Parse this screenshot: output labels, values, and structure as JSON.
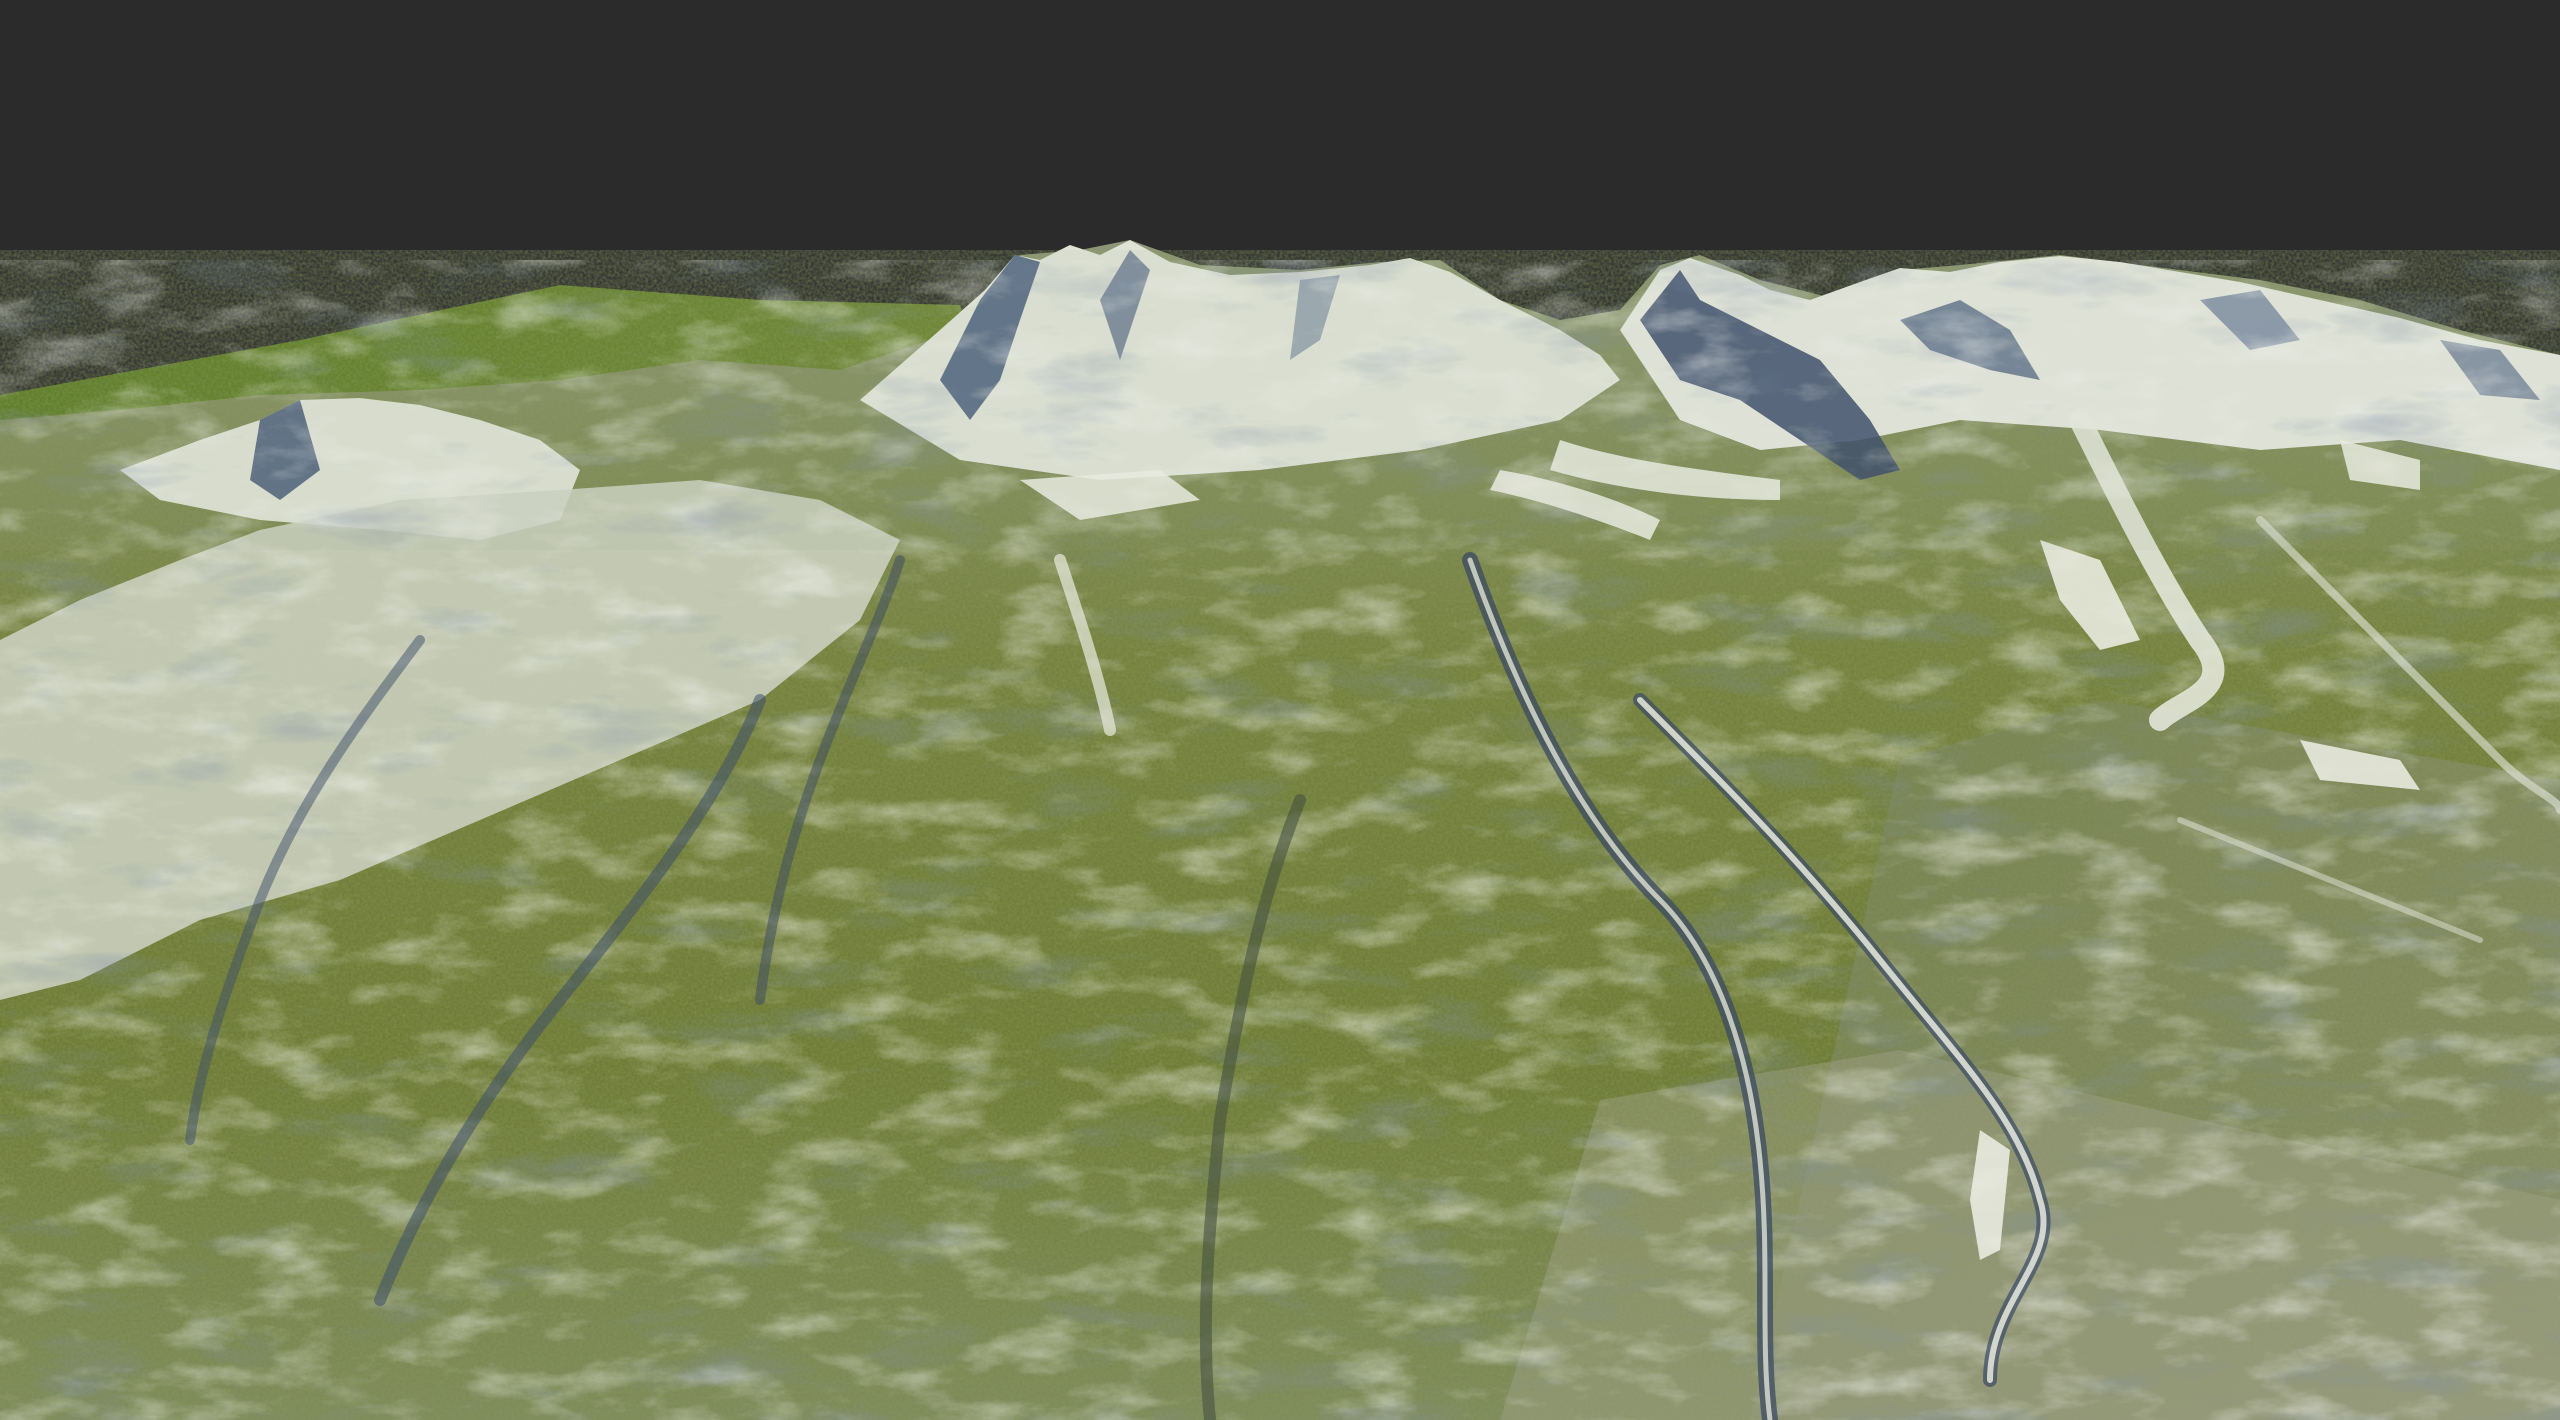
{
  "scene": {
    "type": "3d-terrain-render",
    "background_color": "#2b2b2b",
    "grass_color": "#6f7d3a",
    "far_plateau_color": "#5f7a2c",
    "rock_color": "#7c8a70",
    "snow_color": "#e9ece3",
    "shadow_color": "#3c4b66"
  }
}
